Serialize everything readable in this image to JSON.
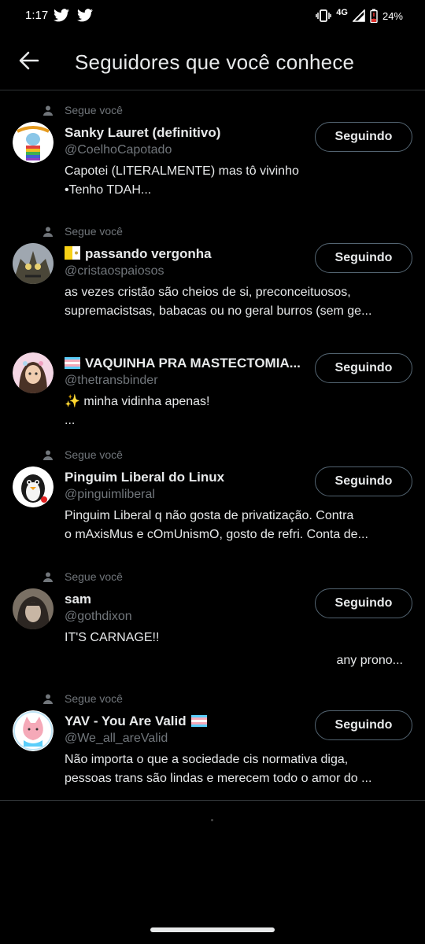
{
  "status_bar": {
    "time": "1:17",
    "network": "4G",
    "battery": "24%",
    "icons": [
      "twitter-icon",
      "twitter-icon",
      "vibrate-icon",
      "signal-icon",
      "battery-icon"
    ]
  },
  "header": {
    "back_icon": "arrow-left-icon",
    "title": "Seguidores que você conhece"
  },
  "follows_you_label": "Segue você",
  "follow_button_label": "Seguindo",
  "users": [
    {
      "name": "Sanky Lauret (definitivo)",
      "handle": "@CoelhoCapotado",
      "follows_you": true,
      "bio": [
        "Capotei (LITERALMENTE) mas tô vivinho",
        "•Tenho TDAH..."
      ]
    },
    {
      "name": "passando vergonha",
      "name_prefix_icon": "vatican-flag-icon",
      "handle": "@cristaospaiosos",
      "follows_you": true,
      "bio": [
        "as vezes cristão são cheios de si, preconceituosos,",
        "supremacistsas, babacas ou no geral burros (sem ge..."
      ]
    },
    {
      "name": "VAQUINHA PRA MASTECTOMIA...",
      "name_prefix_icon": "transgender-flag-icon",
      "handle": "@thetransbinder",
      "follows_you": false,
      "bio": [
        "✨ minha vidinha apenas!",
        "..."
      ]
    },
    {
      "name": "Pinguim Liberal do Linux",
      "handle": "@pinguimliberal",
      "follows_you": true,
      "bio": [
        "Pinguim Liberal q não gosta de privatização. Contra",
        "o mAxisMus e cOmUnismO, gosto de refri. Conta de..."
      ]
    },
    {
      "name": "sam",
      "handle": "@gothdixon",
      "follows_you": true,
      "bio": [
        "IT'S CARNAGE!!"
      ],
      "bio_right": "any prono..."
    },
    {
      "name": "YAV - You Are Valid",
      "name_suffix_icon": "transgender-flag-icon",
      "handle": "@We_all_areValid",
      "follows_you": true,
      "bio": [
        "Não importa o que a sociedade cis normativa diga,",
        "pessoas trans são lindas e merecem todo o amor do ..."
      ]
    }
  ],
  "colors": {
    "background": "#000000",
    "text_primary": "#e7e9ea",
    "text_secondary": "#71767b",
    "divider": "#2f3336",
    "button_border": "#536471"
  }
}
